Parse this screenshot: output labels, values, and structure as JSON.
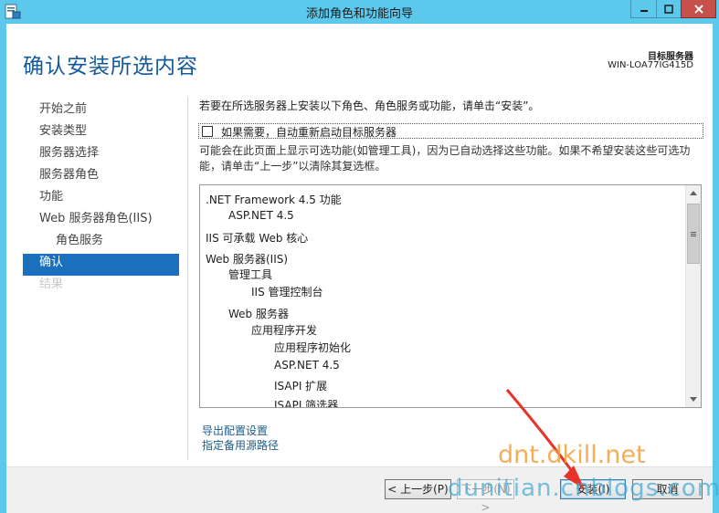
{
  "window": {
    "title": "添加角色和功能向导",
    "minimize_icon": "minimize-icon",
    "maximize_icon": "maximize-icon",
    "close_icon": "close-icon"
  },
  "header": {
    "title": "确认安装所选内容",
    "target_label": "目标服务器",
    "target_name": "WIN-LOA77IG415D"
  },
  "nav": {
    "items": [
      {
        "label": "开始之前",
        "state": "normal"
      },
      {
        "label": "安装类型",
        "state": "normal"
      },
      {
        "label": "服务器选择",
        "state": "normal"
      },
      {
        "label": "服务器角色",
        "state": "normal"
      },
      {
        "label": "功能",
        "state": "normal"
      },
      {
        "label": "Web 服务器角色(IIS)",
        "state": "normal"
      },
      {
        "label": "角色服务",
        "state": "sub"
      },
      {
        "label": "确认",
        "state": "active"
      },
      {
        "label": "结果",
        "state": "disabled"
      }
    ]
  },
  "content": {
    "instruction": "若要在所选服务器上安装以下角色、角色服务或功能，请单击“安装”。",
    "restart_label": "如果需要，自动重新启动目标服务器",
    "note": "可能会在此页面上显示可选功能(如管理工具)，因为已自动选择这些功能。如果不希望安装这些可选功能，请单击“上一步”以清除其复选框。",
    "features": [
      {
        "label": ".NET Framework 4.5 功能",
        "level": 0
      },
      {
        "label": "ASP.NET 4.5",
        "level": 1
      },
      {
        "label": "IIS 可承载 Web 核心",
        "level": 0
      },
      {
        "label": "Web 服务器(IIS)",
        "level": 0
      },
      {
        "label": "管理工具",
        "level": 1
      },
      {
        "label": "IIS 管理控制台",
        "level": 2
      },
      {
        "label": "Web 服务器",
        "level": 1
      },
      {
        "label": "应用程序开发",
        "level": 2
      },
      {
        "label": "应用程序初始化",
        "level": 3
      },
      {
        "label": "ASP.NET 4.5",
        "level": 3
      },
      {
        "label": "ISAPI 扩展",
        "level": 3
      },
      {
        "label": "ISAPI 筛选器",
        "level": 3
      }
    ],
    "export_link": "导出配置设置",
    "source_link": "指定备用源路径"
  },
  "footer": {
    "prev_label": "< 上一步(P)",
    "next_label": "下一步(N) >",
    "install_label": "安装(I)",
    "cancel_label": "取消"
  },
  "watermarks": {
    "line1": "dnt.dkill.net",
    "line2": "dunitian.cnblogs.com"
  },
  "colors": {
    "titlebar": "#5bc8ec",
    "accent": "#1a70bd",
    "header_text": "#14599b",
    "close_button": "#c7504b",
    "annotation_arrow": "#e8332a"
  }
}
